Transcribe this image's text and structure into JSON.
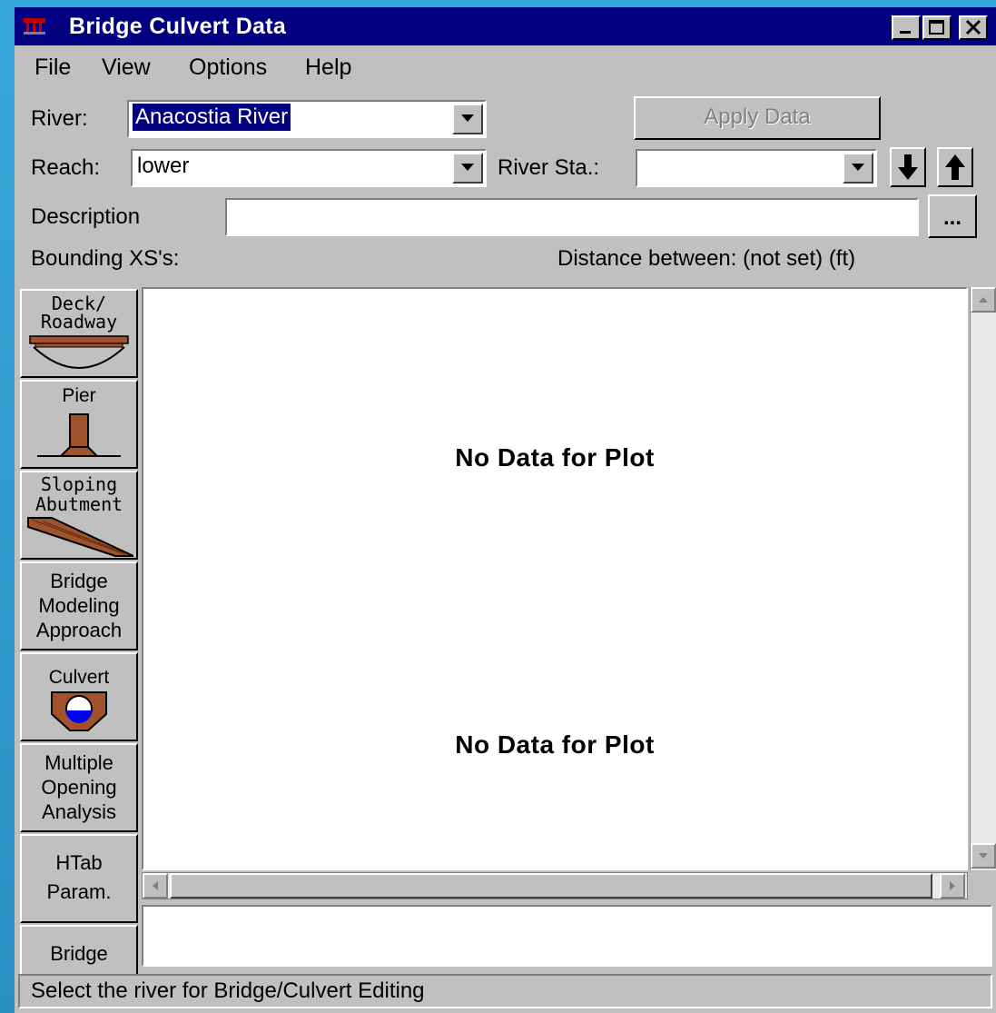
{
  "window": {
    "title": "Bridge Culvert Data",
    "icon": "bridge-app-icon",
    "controls": [
      "minimize-icon",
      "maximize-icon",
      "close-icon"
    ]
  },
  "menu": {
    "file": "File",
    "view": "View",
    "options": "Options",
    "help": "Help"
  },
  "form": {
    "river_label": "River:",
    "river_value": "Anacostia River",
    "reach_label": "Reach:",
    "reach_value": "lower",
    "river_sta_label": "River Sta.:",
    "river_sta_value": "",
    "apply_button": "Apply Data",
    "description_label": "Description",
    "description_value": "",
    "description_browse": "...",
    "bounding_label": "Bounding XS's:",
    "distance_label": "Distance between: (not set) (ft)"
  },
  "sidebar": {
    "items": [
      {
        "label": "Deck/\nRoadway",
        "icon": "deck-roadway-icon"
      },
      {
        "label": "Pier",
        "icon": "pier-icon"
      },
      {
        "label": "Sloping\nAbutment",
        "icon": "sloping-abutment-icon"
      },
      {
        "label": "Bridge\nModeling\nApproach",
        "icon": ""
      },
      {
        "label": "Culvert",
        "icon": "culvert-icon"
      },
      {
        "label": "Multiple\nOpening\nAnalysis",
        "icon": ""
      },
      {
        "label": "HTab\nParam.",
        "icon": ""
      },
      {
        "label": "Bridge",
        "icon": ""
      }
    ]
  },
  "plot": {
    "upstream_message": "No Data for Plot",
    "downstream_message": "No Data for Plot"
  },
  "status": {
    "text": "Select the river for Bridge/Culvert Editing"
  },
  "colors": {
    "title_bar": "#000080",
    "face": "#c0c0c0",
    "deck_brown": "#a0522d",
    "culvert_water": "#0000ff"
  }
}
